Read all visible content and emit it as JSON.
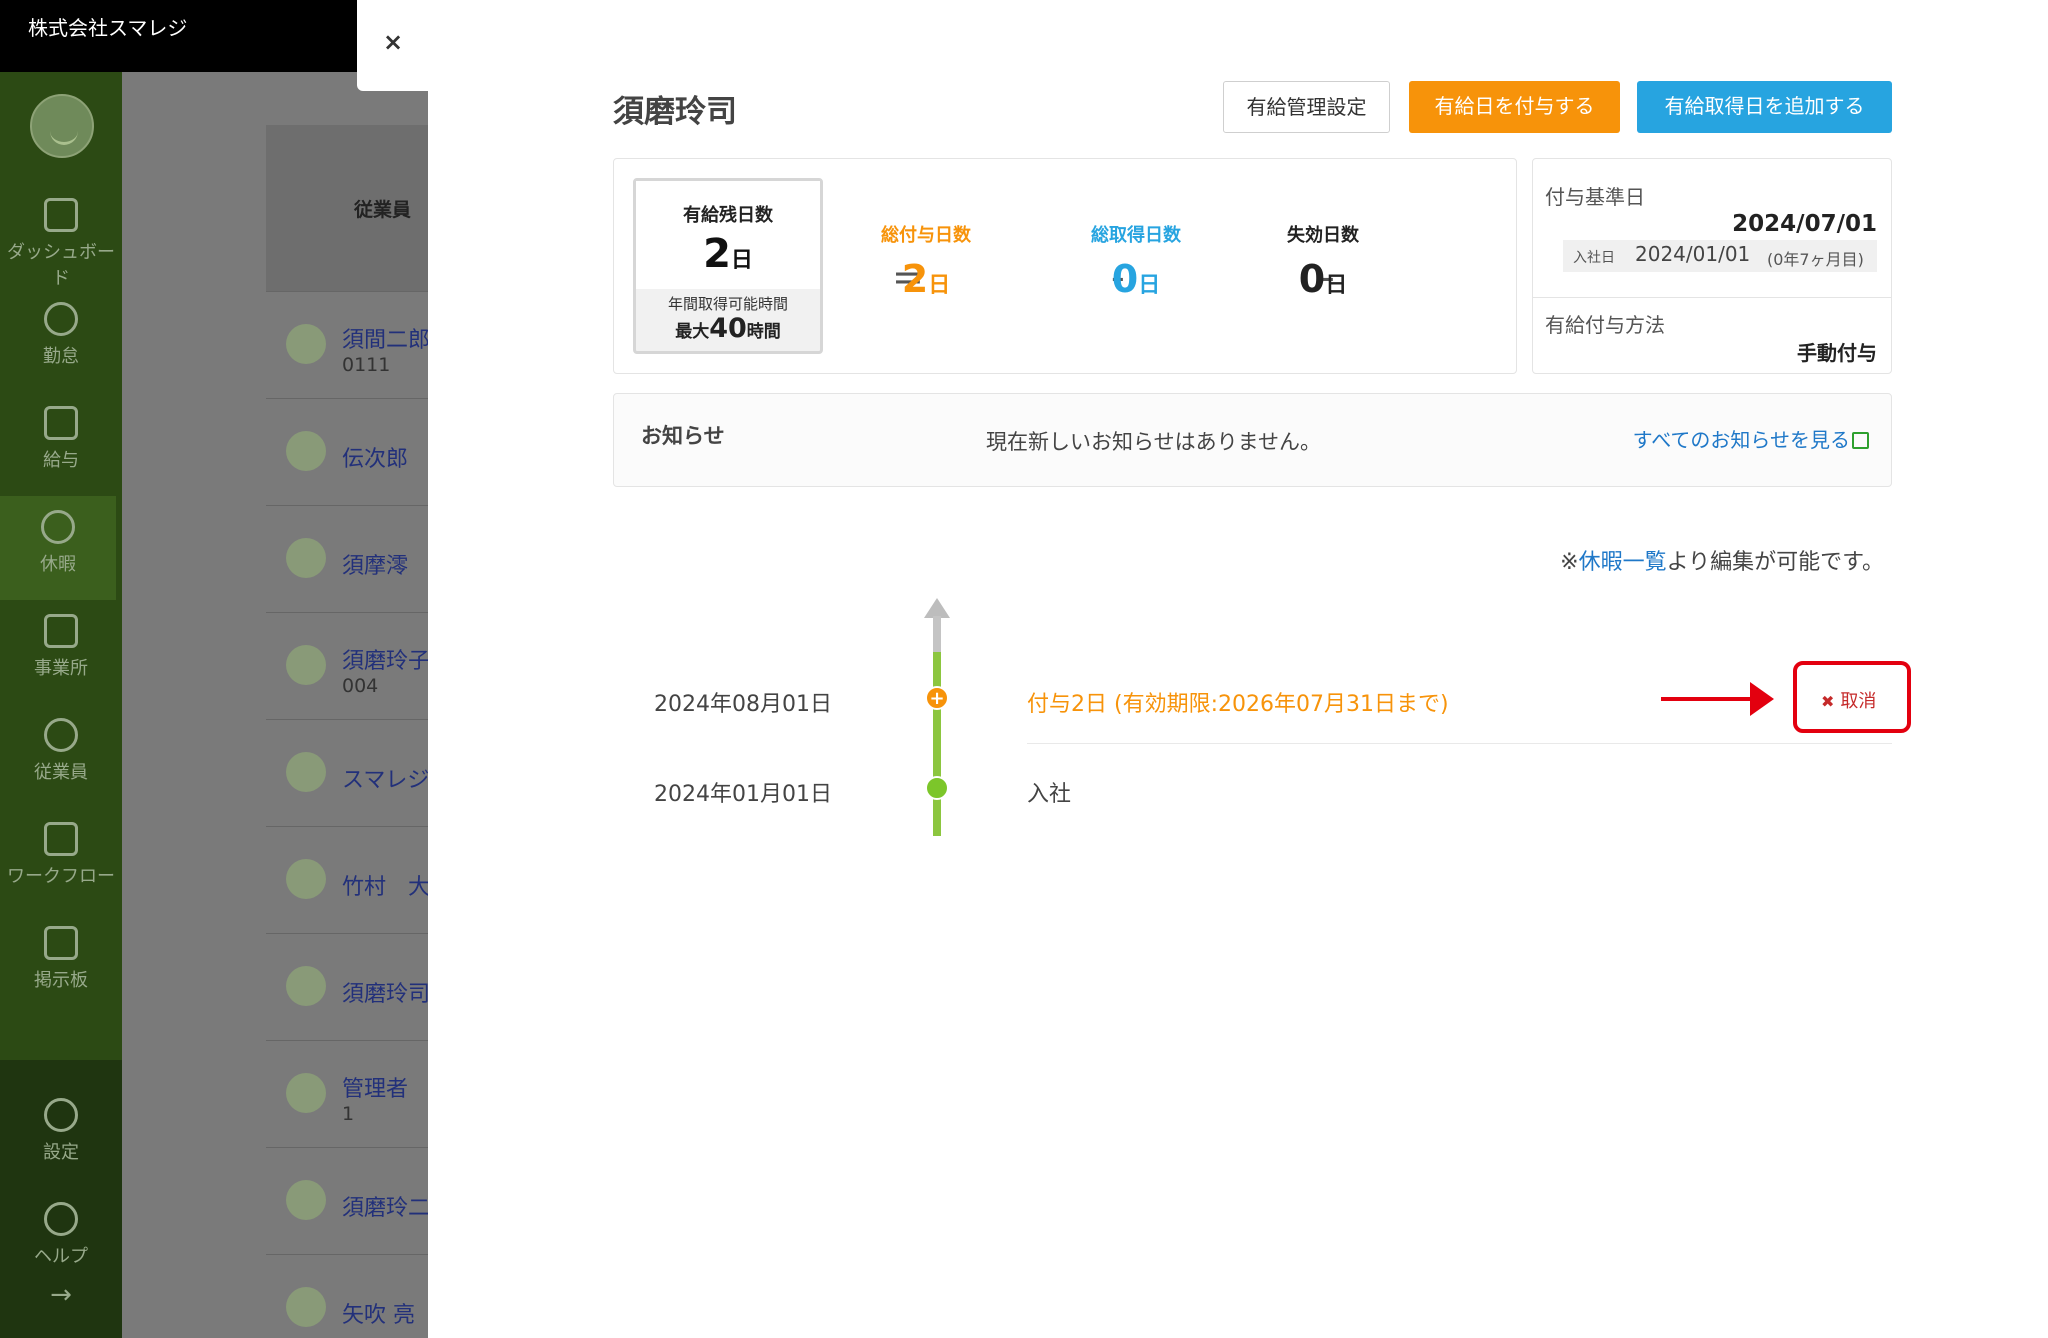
{
  "app": {
    "company": "株式会社スマレジ"
  },
  "sidebar": {
    "items": [
      {
        "label": "ダッシュボード",
        "icon": "dashboard-icon"
      },
      {
        "label": "勤怠",
        "icon": "clock-icon"
      },
      {
        "label": "給与",
        "icon": "calculator-icon"
      },
      {
        "label": "休暇",
        "icon": "umbrella-icon"
      },
      {
        "label": "事業所",
        "icon": "home-icon"
      },
      {
        "label": "従業員",
        "icon": "person-icon"
      },
      {
        "label": "ワークフロー",
        "icon": "workflow-icon"
      },
      {
        "label": "掲示板",
        "icon": "message-icon"
      },
      {
        "label": "設定",
        "icon": "gear-icon"
      },
      {
        "label": "ヘルプ",
        "icon": "help-icon"
      }
    ],
    "expand_icon": "→"
  },
  "background_list": {
    "header": "従業員",
    "rows": [
      {
        "name": "須間二郎",
        "sub": "0111"
      },
      {
        "name": "伝次郎",
        "sub": ""
      },
      {
        "name": "須摩澪",
        "sub": ""
      },
      {
        "name": "須磨玲子",
        "sub": "004"
      },
      {
        "name": "スマレジ",
        "sub": ""
      },
      {
        "name": "竹村　大",
        "sub": ""
      },
      {
        "name": "須磨玲司",
        "sub": ""
      },
      {
        "name": "管理者",
        "sub": "1"
      },
      {
        "name": "須磨玲二",
        "sub": ""
      },
      {
        "name": "矢吹 亮",
        "sub": ""
      }
    ]
  },
  "panel": {
    "close_label": "×",
    "employee_name": "須磨玲司",
    "buttons": {
      "settings": "有給管理設定",
      "grant": "有給日を付与する",
      "add_taken": "有給取得日を追加する"
    },
    "summary": {
      "remaining_label": "有給残日数",
      "remaining_value": "2",
      "day_unit": "日",
      "annual_hours_label": "年間取得可能時間",
      "annual_hours_prefix": "最大",
      "annual_hours_value": "40",
      "annual_hours_unit": "時間",
      "equals": "=",
      "minus": "-",
      "total_granted_label": "総付与日数",
      "total_granted_value": "2",
      "total_taken_label": "総取得日数",
      "total_taken_value": "0",
      "expired_label": "失効日数",
      "expired_value": "0"
    },
    "grant_info": {
      "base_date_label": "付与基準日",
      "base_date": "2024/07/01",
      "join_label": "入社日",
      "join_date": "2024/01/01",
      "tenure": "(0年7ヶ月目)",
      "method_label": "有給付与方法",
      "method": "手動付与"
    },
    "notice": {
      "title": "お知らせ",
      "message": "現在新しいお知らせはありません。",
      "link": "すべてのお知らせを見る"
    },
    "edit_note": {
      "prefix": "※",
      "link": "休暇一覧",
      "suffix": "より編集が可能です。"
    },
    "timeline": [
      {
        "date": "2024年08月01日",
        "text": "付与2日 (有効期限:2026年07月31日まで)",
        "color": "#f7930a",
        "action": "取消"
      },
      {
        "date": "2024年01月01日",
        "text": "入社",
        "color": "#444444"
      }
    ]
  },
  "colors": {
    "orange": "#f7930a",
    "blue": "#27a4e0",
    "sidebar": "#2c4a14",
    "timeline_green": "#8cc63f",
    "highlight_red": "#e3000f"
  }
}
